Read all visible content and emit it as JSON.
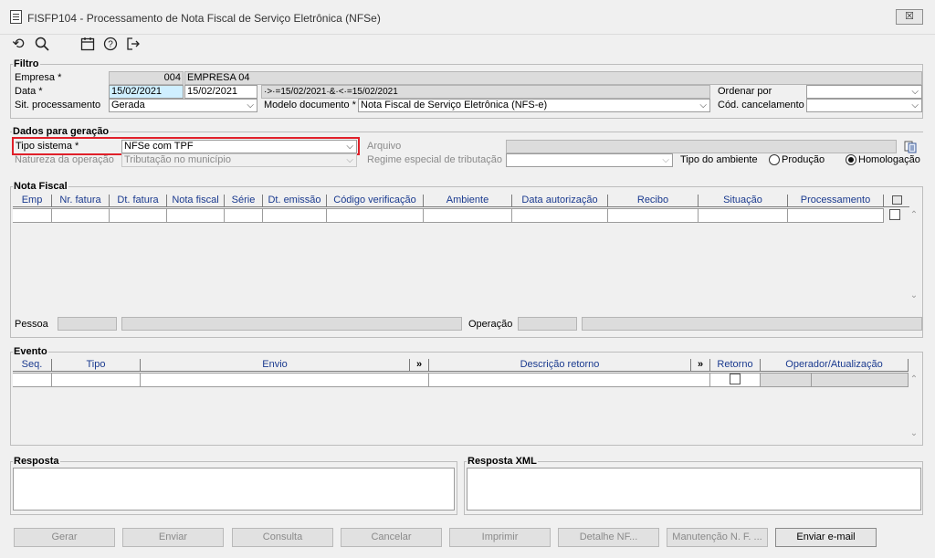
{
  "window": {
    "title": "FISFP104 - Processamento de Nota Fiscal de Serviço Eletrônica (NFSe)",
    "close_glyph": "☒"
  },
  "toolbar": {
    "refresh": "⟲",
    "search": "🔍︎",
    "calendar": "▭",
    "help": "?",
    "exit": "⇥"
  },
  "filtro": {
    "legend": "Filtro",
    "empresa_label": "Empresa *",
    "empresa_code": "004",
    "empresa_name": "EMPRESA 04",
    "data_label": "Data *",
    "data_from": "15/02/2021",
    "data_to": "15/02/2021",
    "data_expr": "·>·=15/02/2021·&·<·=15/02/2021",
    "sit_label": "Sit. processamento",
    "sit_value": "Gerada",
    "modelo_label": "Modelo documento *",
    "modelo_value": "Nota Fiscal de Serviço Eletrônica (NFS-e)",
    "ordenar_label": "Ordenar por",
    "ordenar_value": "",
    "cod_canc_label": "Cód. cancelamento",
    "cod_canc_value": ""
  },
  "dados": {
    "legend": "Dados para geração",
    "tipo_label": "Tipo sistema *",
    "tipo_value": "NFSe com TPF",
    "natureza_label": "Natureza da operação",
    "natureza_value": "Tributação no município",
    "arquivo_label": "Arquivo",
    "regime_label": "Regime especial de tributação",
    "regime_value": "",
    "ambiente_label": "Tipo do ambiente",
    "producao": "Produção",
    "homologacao": "Homologação"
  },
  "nota": {
    "legend": "Nota Fiscal",
    "columns": [
      "Emp",
      "Nr. fatura",
      "Dt. fatura",
      "Nota fiscal",
      "Série",
      "Dt. emissão",
      "Código verificação",
      "Ambiente",
      "Data autorização",
      "Recibo",
      "Situação",
      "Processamento"
    ],
    "pessoa_label": "Pessoa",
    "operacao_label": "Operação"
  },
  "evento": {
    "legend": "Evento",
    "columns": [
      "Seq.",
      "Tipo",
      "Envio",
      "»",
      "Descrição retorno",
      "»",
      "Retorno",
      "Operador/Atualização"
    ]
  },
  "resposta": {
    "legend": "Resposta"
  },
  "resposta_xml": {
    "legend": "Resposta XML"
  },
  "buttons": {
    "gerar": "Gerar",
    "enviar": "Enviar",
    "consulta": "Consulta",
    "cancelar": "Cancelar",
    "imprimir": "Imprimir",
    "detalhe": "Detalhe NF...",
    "manutencao": "Manutenção N. F. ...",
    "email": "Enviar e-mail"
  }
}
